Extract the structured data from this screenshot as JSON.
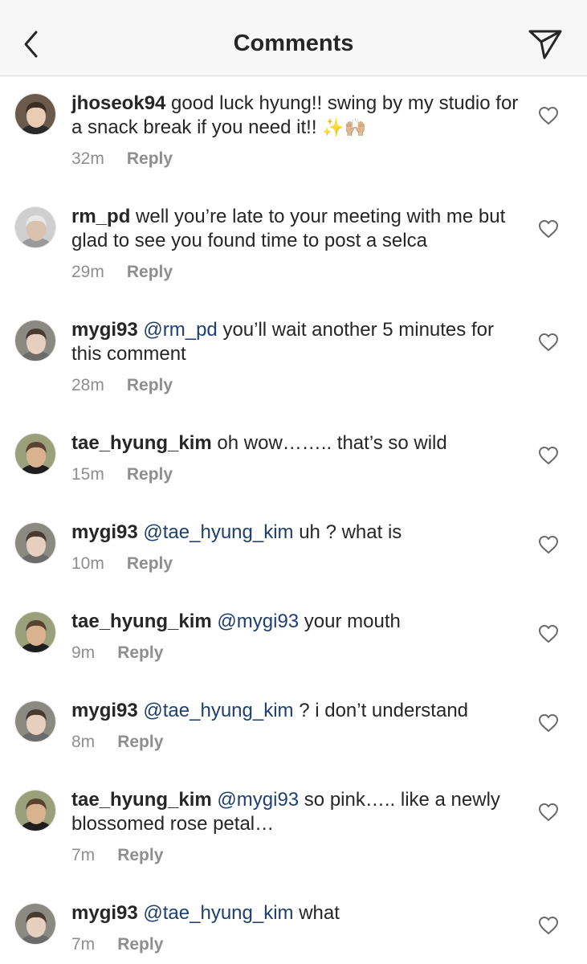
{
  "header": {
    "title": "Comments"
  },
  "reply_label": "Reply",
  "comments": [
    {
      "user": "jhoseok94",
      "mention": "",
      "text": " good luck hyung!! swing by my studio for a snack break if you need it!! ",
      "emoji": "✨🙌🏼",
      "time": "32m",
      "avatar": "hoseok"
    },
    {
      "user": "rm_pd",
      "mention": "",
      "text": " well you’re late to your meeting with me but glad to see you found time to post a selca",
      "emoji": "",
      "time": "29m",
      "avatar": "rm"
    },
    {
      "user": "mygi93",
      "mention": "@rm_pd",
      "text": " you’ll wait another 5 minutes for this comment",
      "emoji": "",
      "time": "28m",
      "avatar": "yoongi"
    },
    {
      "user": "tae_hyung_kim",
      "mention": "",
      "text": " oh wow…….. that’s so wild",
      "emoji": "",
      "time": "15m",
      "avatar": "taehyung"
    },
    {
      "user": "mygi93",
      "mention": "@tae_hyung_kim",
      "text": " uh ? what is",
      "emoji": "",
      "time": "10m",
      "avatar": "yoongi"
    },
    {
      "user": "tae_hyung_kim",
      "mention": "@mygi93",
      "text": " your mouth",
      "emoji": "",
      "time": "9m",
      "avatar": "taehyung"
    },
    {
      "user": "mygi93",
      "mention": "@tae_hyung_kim",
      "text": " ? i don’t understand",
      "emoji": "",
      "time": "8m",
      "avatar": "yoongi"
    },
    {
      "user": "tae_hyung_kim",
      "mention": "@mygi93",
      "text": " so pink….. like a newly blossomed rose petal…",
      "emoji": "",
      "time": "7m",
      "avatar": "taehyung"
    },
    {
      "user": "mygi93",
      "mention": "@tae_hyung_kim",
      "text": " what",
      "emoji": "",
      "time": "7m",
      "avatar": "yoongi"
    }
  ],
  "colors": {
    "header_bg": "#f7f7f7",
    "text": "#262626",
    "mention": "#1d3f72",
    "meta": "#8e8e8e"
  }
}
